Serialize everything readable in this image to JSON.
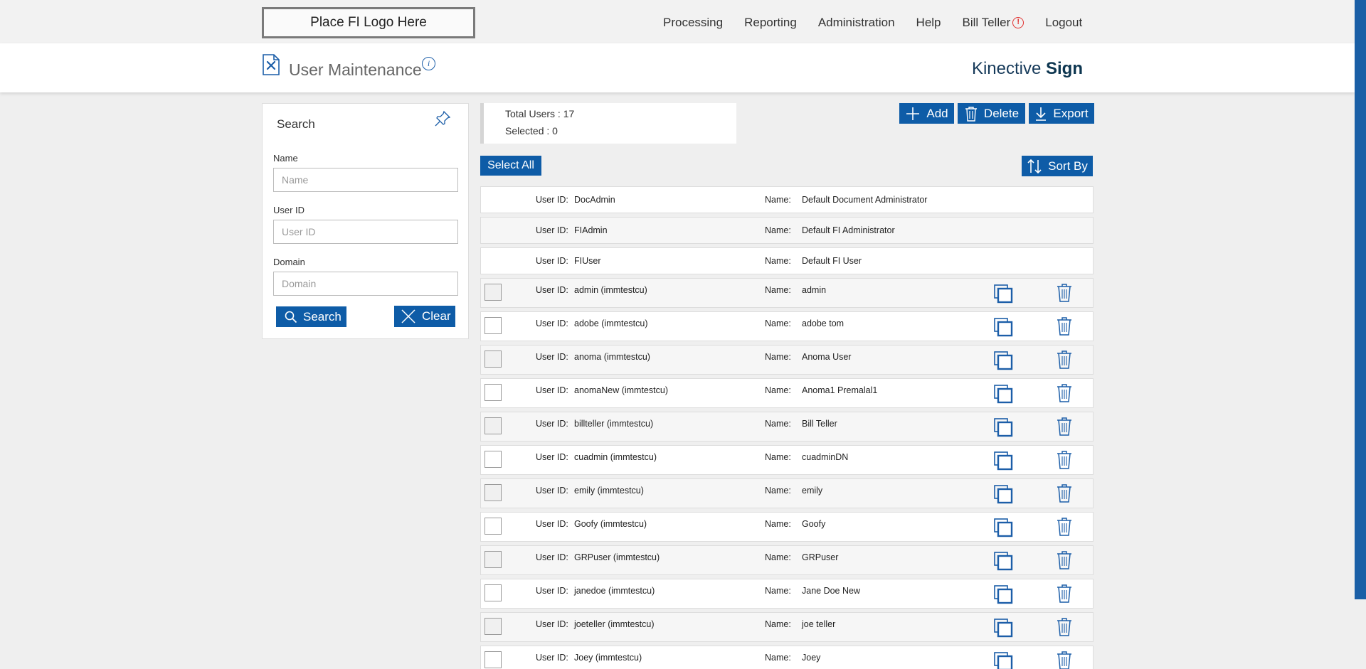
{
  "header": {
    "logo_text": "Place FI Logo Here",
    "nav": [
      "Processing",
      "Reporting",
      "Administration",
      "Help"
    ],
    "user_name": "Bill Teller",
    "logout": "Logout"
  },
  "page": {
    "title": "User Maintenance",
    "brand_light": "Kinective",
    "brand_bold": "Sign",
    "accent_color": "#0e5ca7"
  },
  "search": {
    "title": "Search",
    "name_label": "Name",
    "name_placeholder": "Name",
    "userid_label": "User ID",
    "userid_placeholder": "User ID",
    "domain_label": "Domain",
    "domain_placeholder": "Domain",
    "search_button": "Search",
    "clear_button": "Clear"
  },
  "summary": {
    "total_users": "Total Users : 17",
    "selected": "Selected : 0"
  },
  "toolbar": {
    "add": "Add",
    "delete": "Delete",
    "export": "Export",
    "select_all": "Select All",
    "sort_by": "Sort By"
  },
  "labels": {
    "user_id": "User ID:",
    "name": "Name:"
  },
  "users": [
    {
      "user_id": "DocAdmin",
      "name": "Default Document Administrator",
      "system": true
    },
    {
      "user_id": "FIAdmin",
      "name": "Default FI Administrator",
      "system": true
    },
    {
      "user_id": "FIUser",
      "name": "Default FI User",
      "system": true
    },
    {
      "user_id": "admin (immtestcu)",
      "name": "admin",
      "system": false
    },
    {
      "user_id": "adobe (immtestcu)",
      "name": "adobe tom",
      "system": false
    },
    {
      "user_id": "anoma (immtestcu)",
      "name": "Anoma User",
      "system": false
    },
    {
      "user_id": "anomaNew (immtestcu)",
      "name": "Anoma1 Premalal1",
      "system": false
    },
    {
      "user_id": "billteller (immtestcu)",
      "name": "Bill Teller",
      "system": false
    },
    {
      "user_id": "cuadmin (immtestcu)",
      "name": "cuadminDN",
      "system": false
    },
    {
      "user_id": "emily (immtestcu)",
      "name": "emily",
      "system": false
    },
    {
      "user_id": "Goofy (immtestcu)",
      "name": "Goofy",
      "system": false
    },
    {
      "user_id": "GRPuser (immtestcu)",
      "name": "GRPuser",
      "system": false
    },
    {
      "user_id": "janedoe (immtestcu)",
      "name": "Jane Doe New",
      "system": false
    },
    {
      "user_id": "joeteller (immtestcu)",
      "name": "joe teller",
      "system": false
    },
    {
      "user_id": "Joey (immtestcu)",
      "name": "Joey",
      "system": false
    }
  ]
}
